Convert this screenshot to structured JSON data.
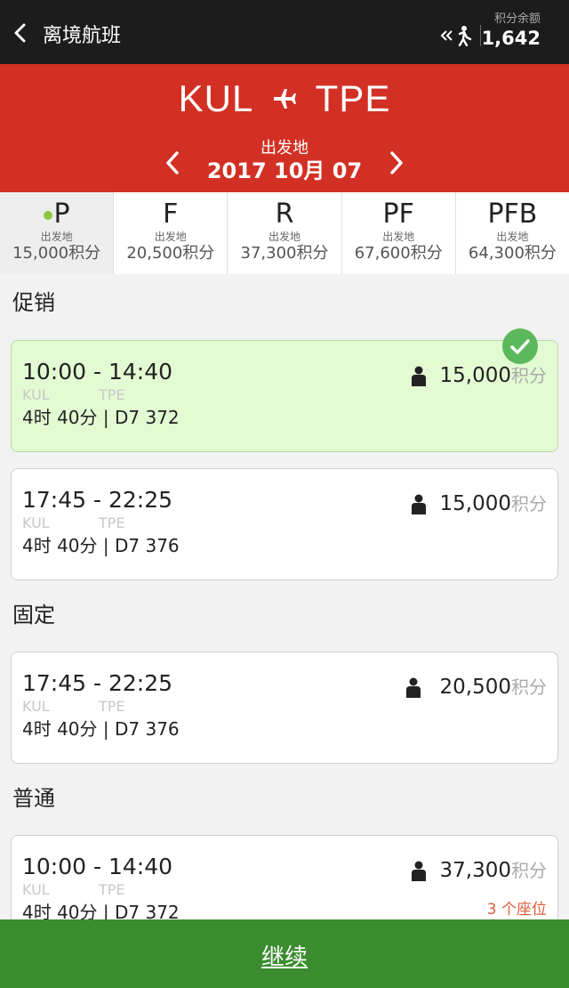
{
  "topbar": {
    "title": "离境航班",
    "points_label": "积分余额",
    "points_value": "1,642"
  },
  "route": {
    "origin": "KUL",
    "destination": "TPE",
    "date_label": "出发地",
    "date_value": "2017 10月 07"
  },
  "fare_tabs": [
    {
      "code": "P",
      "sub": "出发地",
      "price": "15,000积分",
      "active": true
    },
    {
      "code": "F",
      "sub": "出发地",
      "price": "20,500积分",
      "active": false
    },
    {
      "code": "R",
      "sub": "出发地",
      "price": "37,300积分",
      "active": false
    },
    {
      "code": "PF",
      "sub": "出发地",
      "price": "67,600积分",
      "active": false
    },
    {
      "code": "PFB",
      "sub": "出发地",
      "price": "64,300积分",
      "active": false
    }
  ],
  "sections": {
    "promo": "促销",
    "fixed": "固定",
    "regular": "普通"
  },
  "flights": [
    {
      "times": "10:00 - 14:40",
      "origin": "KUL",
      "dest": "TPE",
      "meta": "4时 40分 | D7  372",
      "price": "15,000",
      "unit": "积分",
      "selected": true
    },
    {
      "times": "17:45 - 22:25",
      "origin": "KUL",
      "dest": "TPE",
      "meta": "4时 40分 | D7  376",
      "price": "15,000",
      "unit": "积分",
      "selected": false
    },
    {
      "times": "17:45 - 22:25",
      "origin": "KUL",
      "dest": "TPE",
      "meta": "4时 40分 | D7  376",
      "price": "20,500",
      "unit": "积分",
      "selected": false
    },
    {
      "times": "10:00 - 14:40",
      "origin": "KUL",
      "dest": "TPE",
      "meta": "4时 40分 | D7  372",
      "price": "37,300",
      "unit": "积分",
      "selected": false,
      "seats": "3 个座位"
    }
  ],
  "continue_label": "继续",
  "colors": {
    "topbar": "#1c1c1c",
    "header": "#d23024",
    "selected_card": "#e3fbd3",
    "check": "#5cb85c",
    "continue": "#3a8c2f",
    "seats": "#e05a3a"
  }
}
